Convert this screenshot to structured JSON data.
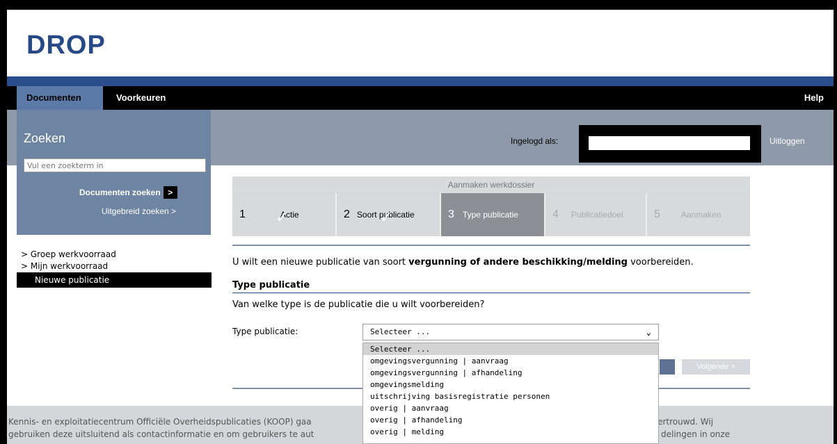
{
  "app": {
    "logo": "DROP"
  },
  "nav": {
    "tabs": [
      "Documenten",
      "Voorkeuren"
    ],
    "help": "Help"
  },
  "search": {
    "title": "Zoeken",
    "placeholder": "Vul een zoekterm in",
    "button_label": "Documenten zoeken",
    "button_arrow": ">",
    "advanced_label": "Uitgebreid zoeken >"
  },
  "session": {
    "logged_in_label": "Ingelogd als:",
    "logout_label": "Uitloggen"
  },
  "sidebar": {
    "items": [
      {
        "label": "> Groep werkvoorraad",
        "active": false
      },
      {
        "label": "> Mijn werkvoorraad",
        "active": false
      },
      {
        "label": "Nieuwe publicatie",
        "active": true
      }
    ]
  },
  "wizard": {
    "title": "Aanmaken werkdossier",
    "steps": [
      {
        "num": "1",
        "label": "Actie",
        "state": "done"
      },
      {
        "num": "2",
        "label": "Soort publicatie",
        "state": "done"
      },
      {
        "num": "3",
        "label": "Type publicatie",
        "state": "active"
      },
      {
        "num": "4",
        "label": "Publicatiedoel",
        "state": "disabled"
      },
      {
        "num": "5",
        "label": "Aanmaken",
        "state": "disabled"
      }
    ]
  },
  "main": {
    "intro_prefix": "U wilt een nieuwe publicatie van soort ",
    "intro_bold": "vergunning of andere beschikking/melding",
    "intro_suffix": " voorbereiden.",
    "section_title": "Type publicatie",
    "question": "Van welke type is de publicatie die u wilt voorbereiden?",
    "field_label": "Type publicatie:",
    "select_value": "Selecteer ...",
    "options": [
      "Selecteer ...",
      "omgevingsvergunning | aanvraag",
      "omgevingsvergunning | afhandeling",
      "omgevingsmelding",
      "uitschrijving basisregistratie personen",
      "overig | aanvraag",
      "overig | afhandeling",
      "overig | melding"
    ],
    "next_label": "Volgende >"
  },
  "footer": {
    "line1_left": "Kennis- en exploitatiecentrum Officiële Overheidspublicaties (KOOP) gaa",
    "line2_left": "gebruiken deze uitsluitend als contactinformatie en om gebruikers te aut",
    "line1_right": "vertrouwd. Wij",
    "line2_right": "delingen in onze"
  },
  "colors": {
    "brand_blue": "#2c4d8c",
    "nav_black": "#000000",
    "panel_gray": "#8e9aaa"
  }
}
